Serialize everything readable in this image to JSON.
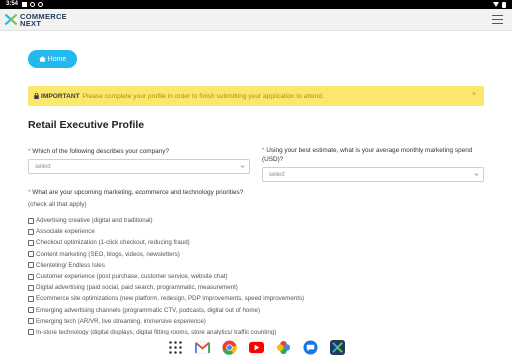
{
  "status_bar": {
    "time": "3:54"
  },
  "header": {
    "logo_line1": "COMMERCE",
    "logo_line2": "NEXT"
  },
  "home_button": {
    "label": "Home"
  },
  "alert": {
    "label": "IMPORTANT",
    "message": "Please complete your profile in order to finish submitting your application to attend.",
    "close": "×"
  },
  "profile": {
    "title": "Retail Executive Profile",
    "q1": {
      "label": "Which of the following describes your company?",
      "selected": "select"
    },
    "q2": {
      "label": "Using your best estimate, what is your average monthly marketing spend (USD)?",
      "selected": "select"
    },
    "q3": {
      "label": "What are your upcoming marketing, ecommerce and technology priorities?",
      "note": "(check all that apply)",
      "options": [
        "Advertising creative (digital and traditional)",
        "Associate experience",
        "Checkout optimization (1-click checkout, reducing fraud)",
        "Content marketing (SEO, blogs, videos, newsletters)",
        "Clienteling/ Endless Isles",
        "Customer experience (post purchase, customer service, website chat)",
        "Digital advertising (paid social, paid search, programmatic, measurement)",
        "Ecommerce site optimizations (new platform, redesign, PDP improvements, speed improvements)",
        "Emerging advertising channels (programmatic CTV, podcasts, digital out of home)",
        "Emerging tech (AR/VR, live streaming, immersive experience)",
        "In-store technology (digital displays, digital fitting rooms, store analytics/ traffic counting)"
      ]
    },
    "required_mark": "*"
  },
  "colors": {
    "accent": "#22b9ee",
    "alert_bg": "#fbe76c",
    "alert_text": "#c08a00",
    "required": "#d9534f"
  },
  "nav_icons": [
    "apps-grid-icon",
    "gmail-icon",
    "chrome-icon",
    "youtube-icon",
    "photos-icon",
    "messages-icon",
    "commercenext-app-icon"
  ]
}
